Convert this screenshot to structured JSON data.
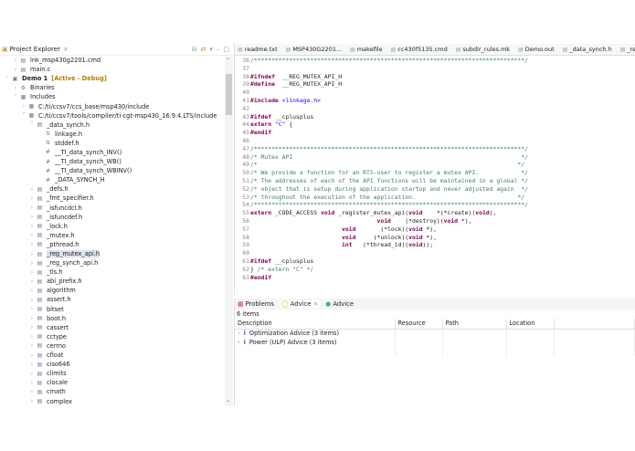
{
  "explorer": {
    "title": "Project Explorer",
    "items": [
      {
        "d": 1,
        "tw": ">",
        "ic": "file",
        "label": "lnk_msp430g2201.cmd"
      },
      {
        "d": 1,
        "tw": ">",
        "ic": "file",
        "label": "main.c"
      },
      {
        "d": 0,
        "tw": "v",
        "ic": "project",
        "label": "Demo 1",
        "extra": "[Active - Debug]",
        "bold": true
      },
      {
        "d": 1,
        "tw": ">",
        "ic": "binaries",
        "label": "Binaries"
      },
      {
        "d": 1,
        "tw": "v",
        "ic": "folder",
        "label": "Includes"
      },
      {
        "d": 2,
        "tw": ">",
        "ic": "folder",
        "label": "C:/ti/ccsv7/ccs_base/msp430/include"
      },
      {
        "d": 2,
        "tw": "v",
        "ic": "folder",
        "label": "C:/ti/ccsv7/tools/compiler/ti-cgt-msp430_16.9.4.LTS/include"
      },
      {
        "d": 3,
        "tw": "v",
        "ic": "header",
        "label": "_data_synch.h"
      },
      {
        "d": 4,
        "tw": "",
        "ic": "include",
        "label": "linkage.h"
      },
      {
        "d": 4,
        "tw": "",
        "ic": "include",
        "label": "stddef.h"
      },
      {
        "d": 4,
        "tw": "",
        "ic": "macro",
        "label": "__TI_data_synch_INV()"
      },
      {
        "d": 4,
        "tw": "",
        "ic": "macro",
        "label": "__TI_data_synch_WB()"
      },
      {
        "d": 4,
        "tw": "",
        "ic": "macro",
        "label": "__TI_data_synch_WBINV()"
      },
      {
        "d": 4,
        "tw": "",
        "ic": "macro",
        "label": "_DATA_SYNCH_H"
      },
      {
        "d": 3,
        "tw": ">",
        "ic": "header",
        "label": "_defs.h"
      },
      {
        "d": 3,
        "tw": ">",
        "ic": "header",
        "label": "_fmt_specifier.h"
      },
      {
        "d": 3,
        "tw": ">",
        "ic": "header",
        "label": "_isfuncdcl.h"
      },
      {
        "d": 3,
        "tw": ">",
        "ic": "header",
        "label": "_isfuncdef.h"
      },
      {
        "d": 3,
        "tw": ">",
        "ic": "header",
        "label": "_lock.h"
      },
      {
        "d": 3,
        "tw": ">",
        "ic": "header",
        "label": "_mutex.h"
      },
      {
        "d": 3,
        "tw": ">",
        "ic": "header",
        "label": "_pthread.h"
      },
      {
        "d": 3,
        "tw": ">",
        "ic": "header",
        "label": "_reg_mutex_api.h",
        "selected": true
      },
      {
        "d": 3,
        "tw": ">",
        "ic": "header",
        "label": "_reg_synch_api.h"
      },
      {
        "d": 3,
        "tw": ">",
        "ic": "header",
        "label": "_tls.h"
      },
      {
        "d": 3,
        "tw": ">",
        "ic": "header",
        "label": "abi_prefix.h"
      },
      {
        "d": 3,
        "tw": ">",
        "ic": "header",
        "label": "algorithm"
      },
      {
        "d": 3,
        "tw": ">",
        "ic": "header",
        "label": "assert.h"
      },
      {
        "d": 3,
        "tw": ">",
        "ic": "header",
        "label": "bitset"
      },
      {
        "d": 3,
        "tw": ">",
        "ic": "header",
        "label": "boot.h"
      },
      {
        "d": 3,
        "tw": ">",
        "ic": "header",
        "label": "cassert"
      },
      {
        "d": 3,
        "tw": ">",
        "ic": "header",
        "label": "cctype"
      },
      {
        "d": 3,
        "tw": ">",
        "ic": "header",
        "label": "cerrno"
      },
      {
        "d": 3,
        "tw": ">",
        "ic": "header",
        "label": "cfloat"
      },
      {
        "d": 3,
        "tw": ">",
        "ic": "header",
        "label": "ciso646"
      },
      {
        "d": 3,
        "tw": ">",
        "ic": "header",
        "label": "climits"
      },
      {
        "d": 3,
        "tw": ">",
        "ic": "header",
        "label": "clocale"
      },
      {
        "d": 3,
        "tw": ">",
        "ic": "header",
        "label": "cmath"
      },
      {
        "d": 3,
        "tw": ">",
        "ic": "header",
        "label": "complex"
      }
    ]
  },
  "editor": {
    "tabs": [
      "readme.txt",
      "MSP430G2201...",
      "makefile",
      "cc430f5135.cmd",
      "subdir_rules.mk",
      "Demo.out",
      "_data_synch.h",
      "_reg"
    ],
    "lines": [
      {
        "n": "36",
        "segs": [
          [
            "cm",
            "/*****************************************************************************/"
          ]
        ]
      },
      {
        "n": "37",
        "segs": []
      },
      {
        "n": "38",
        "segs": [
          [
            "k",
            "#ifndef"
          ],
          [
            "",
            "  __REG_MUTEX_API_H"
          ]
        ]
      },
      {
        "n": "39",
        "segs": [
          [
            "k",
            "#define"
          ],
          [
            "",
            "  __REG_MUTEX_API_H"
          ]
        ]
      },
      {
        "n": "40",
        "segs": []
      },
      {
        "n": "41",
        "segs": [
          [
            "k",
            "#include"
          ],
          [
            "",
            " "
          ],
          [
            "s",
            "<linkage.h>"
          ]
        ]
      },
      {
        "n": "42",
        "segs": []
      },
      {
        "n": "43",
        "segs": [
          [
            "k",
            "#ifdef"
          ],
          [
            "",
            " __cplusplus"
          ]
        ]
      },
      {
        "n": "44",
        "segs": [
          [
            "k",
            "extern"
          ],
          [
            "",
            " "
          ],
          [
            "s",
            "\"C\""
          ],
          [
            "",
            " {"
          ]
        ]
      },
      {
        "n": "45",
        "segs": [
          [
            "k",
            "#endif"
          ]
        ]
      },
      {
        "n": "46",
        "segs": []
      },
      {
        "n": "47",
        "segs": [
          [
            "cm",
            "/*****************************************************************************/"
          ]
        ]
      },
      {
        "n": "48",
        "segs": [
          [
            "cm",
            "/* Mutex API                                                                 */"
          ]
        ]
      },
      {
        "n": "49",
        "segs": [
          [
            "cm",
            "/*                                                                          */"
          ]
        ]
      },
      {
        "n": "50",
        "segs": [
          [
            "cm",
            "/* We provide a function for an RTS-user to register a mutex API.            */"
          ]
        ]
      },
      {
        "n": "51",
        "segs": [
          [
            "cm",
            "/* The addresses of each of the API functions will be maintained in a global */"
          ]
        ]
      },
      {
        "n": "52",
        "segs": [
          [
            "cm",
            "/* object that is setup during application startup and never adjusted again  */"
          ]
        ]
      },
      {
        "n": "53",
        "segs": [
          [
            "cm",
            "/* throughout the execution of the application.                             */"
          ]
        ]
      },
      {
        "n": "54",
        "segs": [
          [
            "cm",
            "/*****************************************************************************/"
          ]
        ]
      },
      {
        "n": "55",
        "segs": [
          [
            "k",
            "extern"
          ],
          [
            "",
            " _CODE_ACCESS "
          ],
          [
            "k",
            "void"
          ],
          [
            "",
            " _register_mutex_api("
          ],
          [
            "k",
            "void"
          ],
          [
            "",
            "    *(*create)("
          ],
          [
            "k",
            "void"
          ],
          [
            "",
            "),"
          ]
        ]
      },
      {
        "n": "56",
        "segs": [
          [
            "",
            "                                    "
          ],
          [
            "k",
            "void"
          ],
          [
            "",
            "    (*destroy)("
          ],
          [
            "k",
            "void"
          ],
          [
            "",
            " *),"
          ]
        ]
      },
      {
        "n": "57",
        "segs": [
          [
            "",
            "                          "
          ],
          [
            "k",
            "void"
          ],
          [
            "",
            "       (*lock)("
          ],
          [
            "k",
            "void"
          ],
          [
            "",
            " *),"
          ]
        ]
      },
      {
        "n": "58",
        "segs": [
          [
            "",
            "                          "
          ],
          [
            "k",
            "void"
          ],
          [
            "",
            "     (*unlock)("
          ],
          [
            "k",
            "void"
          ],
          [
            "",
            " *),"
          ]
        ]
      },
      {
        "n": "59",
        "segs": [
          [
            "",
            "                          "
          ],
          [
            "k",
            "int"
          ],
          [
            "",
            "   (*thread_id)("
          ],
          [
            "k",
            "void"
          ],
          [
            "",
            "));"
          ]
        ]
      },
      {
        "n": "60",
        "segs": []
      },
      {
        "n": "61",
        "segs": [
          [
            "k",
            "#ifdef"
          ],
          [
            "",
            " __cplusplus"
          ]
        ]
      },
      {
        "n": "62",
        "segs": [
          [
            "",
            "} "
          ],
          [
            "cm",
            "/* extern \"C\" */"
          ]
        ]
      },
      {
        "n": "63",
        "segs": [
          [
            "k",
            "#endif"
          ]
        ]
      }
    ]
  },
  "panel": {
    "tabs": [
      "Problems",
      "Advice",
      "Advice"
    ],
    "count": "6 items",
    "columns": [
      "Description",
      "Resource",
      "Path",
      "Location"
    ],
    "rows": [
      "Optimization Advice (3 items)",
      "Power (ULP) Advice (3 items)"
    ]
  }
}
